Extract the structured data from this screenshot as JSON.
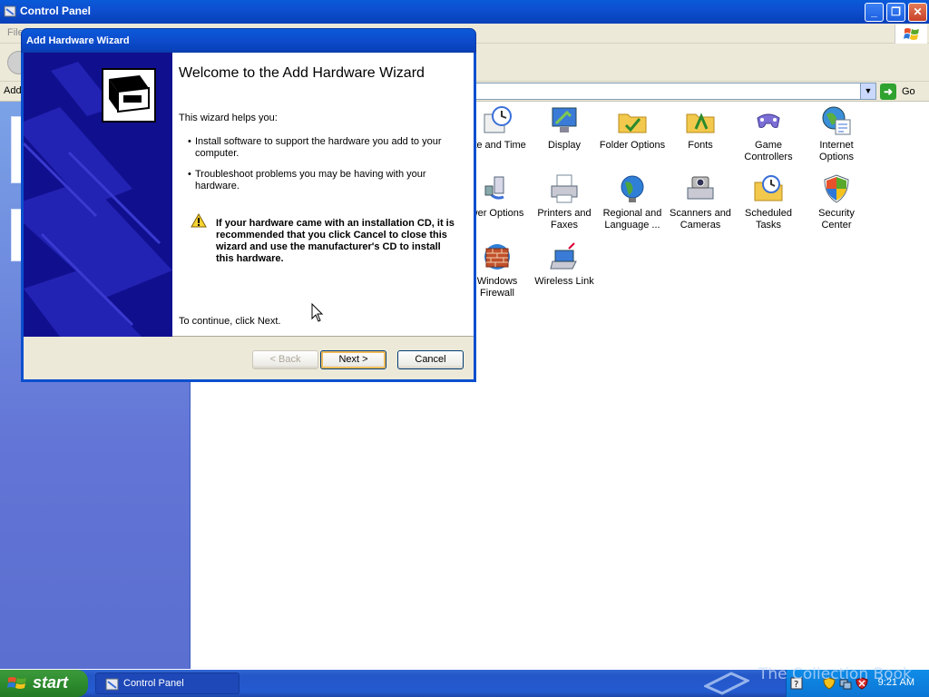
{
  "window": {
    "title": "Control Panel",
    "menu_first": "File",
    "address_label": "Address",
    "go_label": "Go"
  },
  "control_panel_items": [
    {
      "label": "Date and Time",
      "icon": "date-time-icon"
    },
    {
      "label": "Display",
      "icon": "display-icon"
    },
    {
      "label": "Folder Options",
      "icon": "folder-options-icon"
    },
    {
      "label": "Fonts",
      "icon": "fonts-folder-icon"
    },
    {
      "label": "Game Controllers",
      "icon": "game-controllers-icon"
    },
    {
      "label": "Internet Options",
      "icon": "internet-options-icon"
    },
    {
      "label": "Power Options",
      "icon": "power-options-icon"
    },
    {
      "label": "Printers and Faxes",
      "icon": "printers-faxes-icon"
    },
    {
      "label": "Regional and Language ...",
      "icon": "regional-language-icon"
    },
    {
      "label": "Scanners and Cameras",
      "icon": "scanners-cameras-icon"
    },
    {
      "label": "Scheduled Tasks",
      "icon": "scheduled-tasks-icon"
    },
    {
      "label": "Security Center",
      "icon": "security-center-icon"
    },
    {
      "label": "Windows Firewall",
      "icon": "windows-firewall-icon"
    },
    {
      "label": "Wireless Link",
      "icon": "wireless-link-icon"
    }
  ],
  "visible_labels": {
    "date_time_1": "ate and Time",
    "display_1": "Display",
    "folder_1": "Folder Options",
    "fonts_1": "Fonts",
    "game_1": "Game",
    "game_2": "Controllers",
    "internet_1": "Internet",
    "internet_2": "Options",
    "power_1": "wer Options",
    "printers_1": "Printers and",
    "printers_2": "Faxes",
    "regional_1": "Regional and",
    "regional_2": "Language ...",
    "scanners_1": "Scanners and",
    "scanners_2": "Cameras",
    "scheduled_1": "Scheduled",
    "scheduled_2": "Tasks",
    "security_1": "Security",
    "security_2": "Center",
    "firewall_1": "Windows",
    "firewall_2": "Firewall",
    "wireless_1": "Wireless Link"
  },
  "wizard": {
    "title": "Add Hardware Wizard",
    "heading": "Welcome to the Add Hardware Wizard",
    "intro": "This wizard helps you:",
    "bullets": [
      "Install software to support the hardware you add to your computer.",
      "Troubleshoot problems you may be having with your hardware."
    ],
    "warning": "If your hardware came with an installation CD, it is recommended that you click Cancel to close this wizard and use the manufacturer's CD to install this hardware.",
    "continue_text": "To continue, click Next.",
    "buttons": {
      "back": "< Back",
      "next": "Next >",
      "cancel": "Cancel"
    }
  },
  "taskbar": {
    "start_label": "start",
    "task_button": "Control Panel",
    "clock": "9:21 AM",
    "watermark": "The Collection Book"
  },
  "colors": {
    "title_bar": "#0a5ad8",
    "start_green": "#2e8b2e",
    "wizard_art": "#10108f"
  }
}
